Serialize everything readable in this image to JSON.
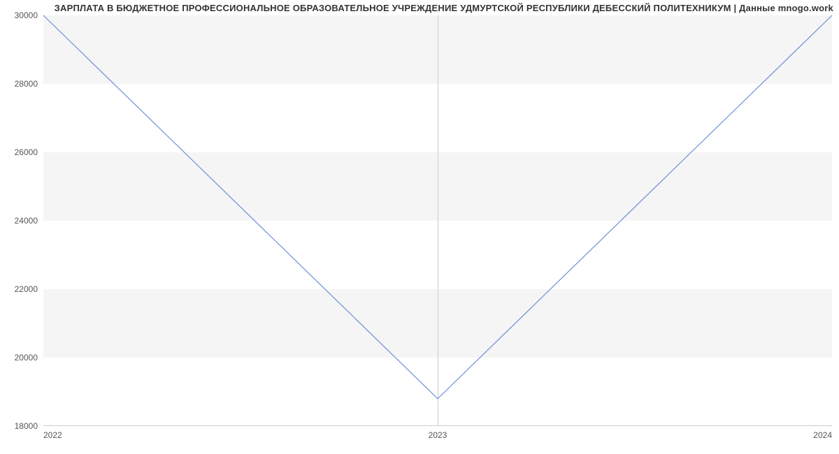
{
  "chart_data": {
    "type": "line",
    "title": "ЗАРПЛАТА В БЮДЖЕТНОЕ ПРОФЕССИОНАЛЬНОЕ ОБРАЗОВАТЕЛЬНОЕ УЧРЕЖДЕНИЕ УДМУРТСКОЙ РЕСПУБЛИКИ ДЕБЕССКИЙ ПОЛИТЕХНИКУМ | Данные mnogo.work",
    "xlabel": "",
    "ylabel": "",
    "x": [
      "2022",
      "2023",
      "2024"
    ],
    "values": [
      30000,
      18800,
      30000
    ],
    "ylim": [
      18000,
      30000
    ],
    "y_ticks": [
      18000,
      20000,
      22000,
      24000,
      26000,
      28000,
      30000
    ],
    "x_ticks": [
      "2022",
      "2023",
      "2024"
    ]
  },
  "ticks": {
    "y0": "18000",
    "y1": "20000",
    "y2": "22000",
    "y3": "24000",
    "y4": "26000",
    "y5": "28000",
    "y6": "30000",
    "x0": "2022",
    "x1": "2023",
    "x2": "2024"
  }
}
